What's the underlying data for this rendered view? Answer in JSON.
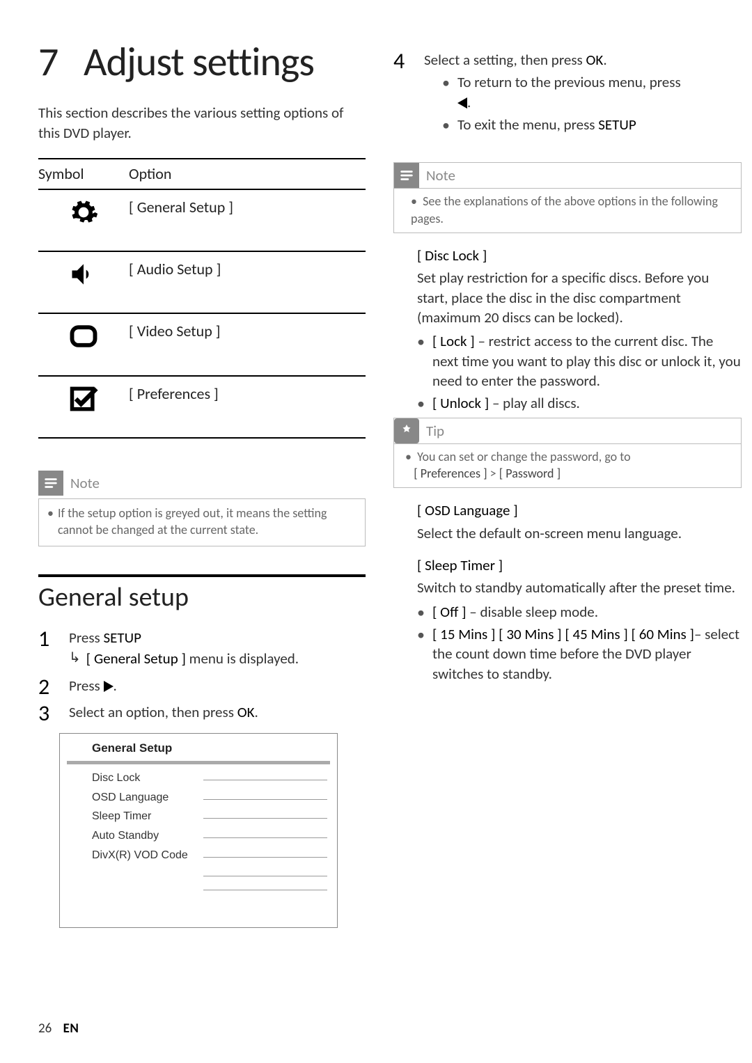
{
  "chapter_number": "7",
  "chapter_title": "Adjust settings",
  "intro": "This section describes the various setting options of this DVD player.",
  "table": {
    "headers": {
      "symbol": "Symbol",
      "option": "Option"
    },
    "rows": [
      {
        "option": "[ General Setup ]"
      },
      {
        "option": "[ Audio Setup ]"
      },
      {
        "option": "[ Video Setup ]"
      },
      {
        "option": "[ Preferences ]"
      }
    ]
  },
  "note_left": {
    "title": "Note",
    "text": "If the setup option is greyed out, it means the setting cannot be changed at the current state."
  },
  "section_title": "General setup",
  "steps_left": {
    "s1_a": "Press ",
    "s1_b": "SETUP",
    "s1_sub_a": "[ General Setup ]",
    "s1_sub_b": " menu is displayed.",
    "s2_a": "Press ",
    "s2_b": ".",
    "s3_a": "Select an option, then press ",
    "s3_b": "OK",
    "s3_c": "."
  },
  "menu_shot": {
    "title": "General Setup",
    "items": [
      "Disc Lock",
      "OSD Language",
      "Sleep Timer",
      "Auto Standby",
      "DivX(R) VOD Code"
    ]
  },
  "right": {
    "s4_a": "Select a setting, then press ",
    "s4_b": "OK",
    "s4_c": ".",
    "s4_sub1": "To return to the previous menu, press ",
    "s4_sub1_b": ".",
    "s4_sub2_a": "To exit the menu, press ",
    "s4_sub2_b": "SETUP"
  },
  "note_right": {
    "title": "Note",
    "text": "See the explanations of the above options in the following pages."
  },
  "disc_lock": {
    "heading": "[ Disc Lock ]",
    "body": "Set play restriction for a specific discs. Before you start, place the disc in the disc compartment (maximum 20 discs can be locked).",
    "b1_label": "[ Lock ]",
    "b1_text": " – restrict access to the current disc. The next time you want to play this disc or unlock it, you need to enter the password.",
    "b2_label": "[ Unlock ]",
    "b2_text": " – play all discs."
  },
  "tip": {
    "title": "Tip",
    "line1": "You can set or change the password, go to",
    "line2_a": "[ Preferences ]",
    "line2_sep": " > ",
    "line2_b": "[ Password ]"
  },
  "osd": {
    "heading": "[ OSD Language ]",
    "body": "Select the default on-screen menu language."
  },
  "sleep": {
    "heading": "[ Sleep Timer ]",
    "body": "Switch to standby automatically after the preset time.",
    "b1_label": "[ Off ]",
    "b1_text": " – disable sleep mode.",
    "b2_labels": "[ 15 Mins ] [ 30 Mins ] [ 45 Mins ] [ 60 Mins ]",
    "b2_text": "– select the count down time before the DVD player switches to standby."
  },
  "footer": {
    "page": "26",
    "lang": "EN"
  }
}
